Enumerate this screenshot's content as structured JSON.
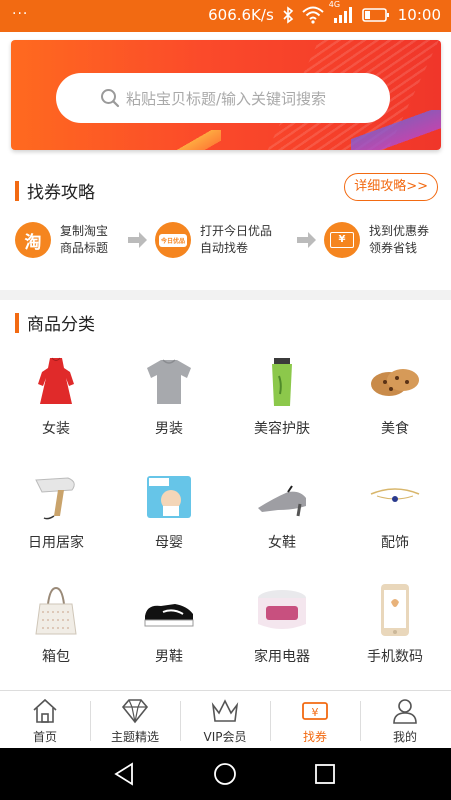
{
  "status_bar": {
    "menu_dots": "···",
    "net_speed": "606.6K/s",
    "signal_label": "4G",
    "time": "10:00"
  },
  "search": {
    "placeholder": "粘贴宝贝标题/输入关键词搜索"
  },
  "guide": {
    "title": "找券攻略",
    "detail_button": "详细攻略>>",
    "steps": [
      {
        "icon_text": "淘",
        "line1": "复制淘宝",
        "line2": "商品标题"
      },
      {
        "icon_text": "今日优品",
        "line1": "打开今日优品",
        "line2": "自动找卷"
      },
      {
        "icon_text": "¥",
        "line1": "找到优惠券",
        "line2": "领券省钱"
      }
    ]
  },
  "categories": {
    "title": "商品分类",
    "items": [
      {
        "label": "女装",
        "icon": "dress-icon"
      },
      {
        "label": "男装",
        "icon": "tshirt-icon"
      },
      {
        "label": "美容护肤",
        "icon": "skincare-tube-icon"
      },
      {
        "label": "美食",
        "icon": "cookies-icon"
      },
      {
        "label": "日用居家",
        "icon": "hair-dryer-icon"
      },
      {
        "label": "母婴",
        "icon": "diapers-icon"
      },
      {
        "label": "女鞋",
        "icon": "womens-shoe-icon"
      },
      {
        "label": "配饰",
        "icon": "bracelet-icon"
      },
      {
        "label": "箱包",
        "icon": "tote-bag-icon"
      },
      {
        "label": "男鞋",
        "icon": "sneaker-icon"
      },
      {
        "label": "家用电器",
        "icon": "rice-cooker-icon"
      },
      {
        "label": "手机数码",
        "icon": "smartphone-icon"
      }
    ]
  },
  "tabbar": {
    "tabs": [
      {
        "label": "首页",
        "icon": "home-icon",
        "active": false
      },
      {
        "label": "主题精选",
        "icon": "diamond-icon",
        "active": false
      },
      {
        "label": "VIP会员",
        "icon": "crown-icon",
        "active": false
      },
      {
        "label": "找券",
        "icon": "coupon-icon",
        "active": true
      },
      {
        "label": "我的",
        "icon": "person-icon",
        "active": false
      }
    ]
  },
  "colors": {
    "accent": "#f26a12",
    "accent_light": "#f5851f"
  }
}
